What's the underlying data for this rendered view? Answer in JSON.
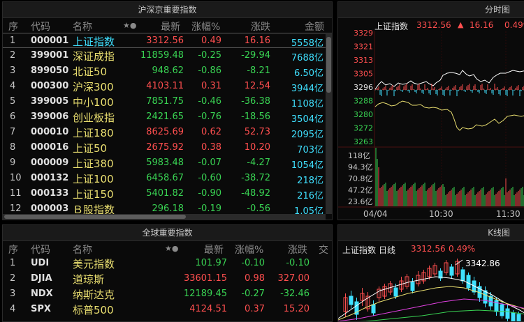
{
  "domestic": {
    "title": "沪深京重要指数",
    "headers": {
      "idx": "序",
      "code": "代码",
      "name": "名称",
      "stars": "★●",
      "latest": "最新",
      "pct": "涨幅%",
      "change": "涨跌",
      "amount": "金额"
    },
    "rows": [
      {
        "idx": "1",
        "code": "000001",
        "name": "上证指数",
        "latest": "3312.56",
        "pct": "0.49",
        "change": "16.16",
        "amount": "5558亿",
        "dir": "up"
      },
      {
        "idx": "2",
        "code": "399001",
        "name": "深证成指",
        "latest": "11859.48",
        "pct": "-0.25",
        "change": "-29.94",
        "amount": "7688亿",
        "dir": "down"
      },
      {
        "idx": "3",
        "code": "899050",
        "name": "北证50",
        "latest": "948.62",
        "pct": "-0.86",
        "change": "-8.21",
        "amount": "6.50亿",
        "dir": "down"
      },
      {
        "idx": "4",
        "code": "000300",
        "name": "沪深300",
        "latest": "4103.11",
        "pct": "0.31",
        "change": "12.54",
        "amount": "3944亿",
        "dir": "up"
      },
      {
        "idx": "5",
        "code": "399005",
        "name": "中小100",
        "latest": "7851.75",
        "pct": "-0.46",
        "change": "-36.38",
        "amount": "1108亿",
        "dir": "down"
      },
      {
        "idx": "6",
        "code": "399006",
        "name": "创业板指",
        "latest": "2421.65",
        "pct": "-0.76",
        "change": "-18.56",
        "amount": "3504亿",
        "dir": "down"
      },
      {
        "idx": "7",
        "code": "000010",
        "name": "上证180",
        "latest": "8625.69",
        "pct": "0.62",
        "change": "52.73",
        "amount": "2095亿",
        "dir": "up"
      },
      {
        "idx": "8",
        "code": "000016",
        "name": "上证50",
        "latest": "2675.92",
        "pct": "0.38",
        "change": "10.20",
        "amount": "703亿",
        "dir": "up"
      },
      {
        "idx": "9",
        "code": "000009",
        "name": "上证380",
        "latest": "5983.48",
        "pct": "-0.07",
        "change": "-4.27",
        "amount": "1054亿",
        "dir": "down"
      },
      {
        "idx": "10",
        "code": "000132",
        "name": "上证100",
        "latest": "6458.67",
        "pct": "-0.60",
        "change": "-38.72",
        "amount": "218亿",
        "dir": "down"
      },
      {
        "idx": "11",
        "code": "000133",
        "name": "上证150",
        "latest": "5401.82",
        "pct": "-0.90",
        "change": "-48.92",
        "amount": "216亿",
        "dir": "down"
      },
      {
        "idx": "12",
        "code": "000003",
        "name": "Ｂ股指数",
        "latest": "296.18",
        "pct": "-0.19",
        "change": "-0.56",
        "amount": "1.05亿",
        "dir": "down"
      }
    ]
  },
  "global": {
    "title": "全球重要指数",
    "headers": {
      "idx": "序",
      "code": "代码",
      "name": "名称",
      "stars": "★●",
      "latest": "最新",
      "pct": "涨幅%",
      "change": "涨跌",
      "extra": "交"
    },
    "rows": [
      {
        "idx": "1",
        "code": "UDI",
        "name": "美元指数",
        "latest": "101.97",
        "pct": "-0.10",
        "change": "-0.10",
        "dir": "down"
      },
      {
        "idx": "2",
        "code": "DJIA",
        "name": "道琼斯",
        "latest": "33601.15",
        "pct": "0.98",
        "change": "327.00",
        "dir": "up"
      },
      {
        "idx": "3",
        "code": "NDX",
        "name": "纳斯达克",
        "latest": "12189.45",
        "pct": "-0.27",
        "change": "-32.46",
        "dir": "down"
      },
      {
        "idx": "4",
        "code": "SPX",
        "name": "标普500",
        "latest": "4124.51",
        "pct": "0.37",
        "change": "15.20",
        "dir": "up"
      }
    ]
  },
  "timeshare": {
    "title": "分时图",
    "name": "上证指数",
    "price": "3312.56",
    "arrow": "▲",
    "change": "16.16",
    "pct": "0.499",
    "price_ticks": [
      "3329",
      "3321",
      "3313",
      "3305",
      "3296",
      "3288",
      "3280",
      "3272",
      "3263"
    ],
    "vol_ticks": [
      "118亿",
      "94.3亿",
      "70.8亿",
      "47.2亿",
      "23.6亿"
    ],
    "time_labels": [
      "04/04",
      "10:30",
      "11:30"
    ]
  },
  "kline": {
    "title": "K线图",
    "name": "上证指数",
    "period": "日线",
    "price": "3312.56",
    "pct": "0.49%",
    "high_marker": "3342.86"
  },
  "colors": {
    "up": "#ff4f4f",
    "down": "#39d353",
    "yellow": "#eadf70",
    "cyan": "#3fe0ff"
  }
}
